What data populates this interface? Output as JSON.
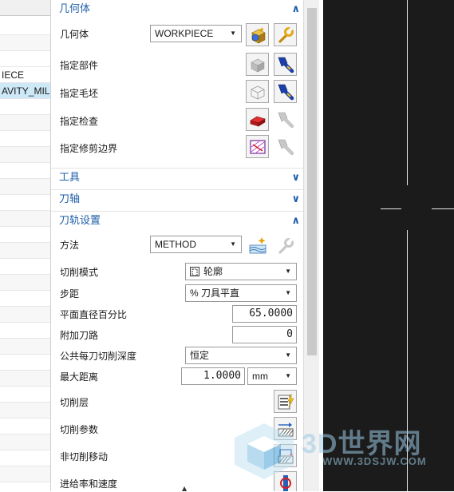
{
  "left_panel": {
    "rows": [
      {
        "text": ""
      },
      {
        "text": ""
      },
      {
        "text": ""
      },
      {
        "text": ""
      },
      {
        "text": "IECE"
      },
      {
        "text": "AVITY_MILL"
      }
    ]
  },
  "geometry_section": {
    "title": "几何体",
    "collapse_glyph": "∧",
    "geometry_label": "几何体",
    "geometry_value": "WORKPIECE",
    "specify_part_label": "指定部件",
    "specify_blank_label": "指定毛坯",
    "specify_check_label": "指定检查",
    "specify_trim_label": "指定修剪边界"
  },
  "tool_section": {
    "title": "工具",
    "expand_glyph": "∨"
  },
  "tool_axis_section": {
    "title": "刀轴",
    "expand_glyph": "∨"
  },
  "path_settings_section": {
    "title": "刀轨设置",
    "collapse_glyph": "∧",
    "method_label": "方法",
    "method_value": "METHOD",
    "cut_pattern_label": "切削模式",
    "cut_pattern_value": "轮廓",
    "stepover_label": "步距",
    "stepover_value": "% 刀具平直",
    "percent_diameter_label": "平面直径百分比",
    "percent_diameter_value": "65.0000",
    "additional_passes_label": "附加刀路",
    "additional_passes_value": "0",
    "common_depth_label": "公共每刀切削深度",
    "common_depth_value": "恒定",
    "max_distance_label": "最大距离",
    "max_distance_value": "1.0000",
    "max_distance_unit": "mm",
    "cut_levels_label": "切削层",
    "cutting_params_label": "切削参数",
    "non_cutting_label": "非切削移动",
    "feeds_speeds_label": "进给率和速度"
  },
  "watermark": {
    "brand": "3D世界网",
    "url": "WWW.3DSJW.COM"
  },
  "colors": {
    "section_title": "#1f5fa8",
    "selected_row": "#cde8f7",
    "graphics_bg": "#1b1b1b"
  },
  "icons": {
    "geometry_new": "geometry-new-icon",
    "wrench": "wrench-icon",
    "flashlight": "flashlight-icon",
    "part_cube": "part-cube-icon",
    "blank_box": "blank-box-icon",
    "check_body": "check-body-icon",
    "trim_boundary": "trim-boundary-icon",
    "method_new": "method-new-icon",
    "cut_levels": "cut-levels-icon",
    "cutting_params": "cutting-params-icon",
    "non_cutting": "non-cutting-moves-icon",
    "feeds_speeds": "feeds-speeds-icon"
  }
}
